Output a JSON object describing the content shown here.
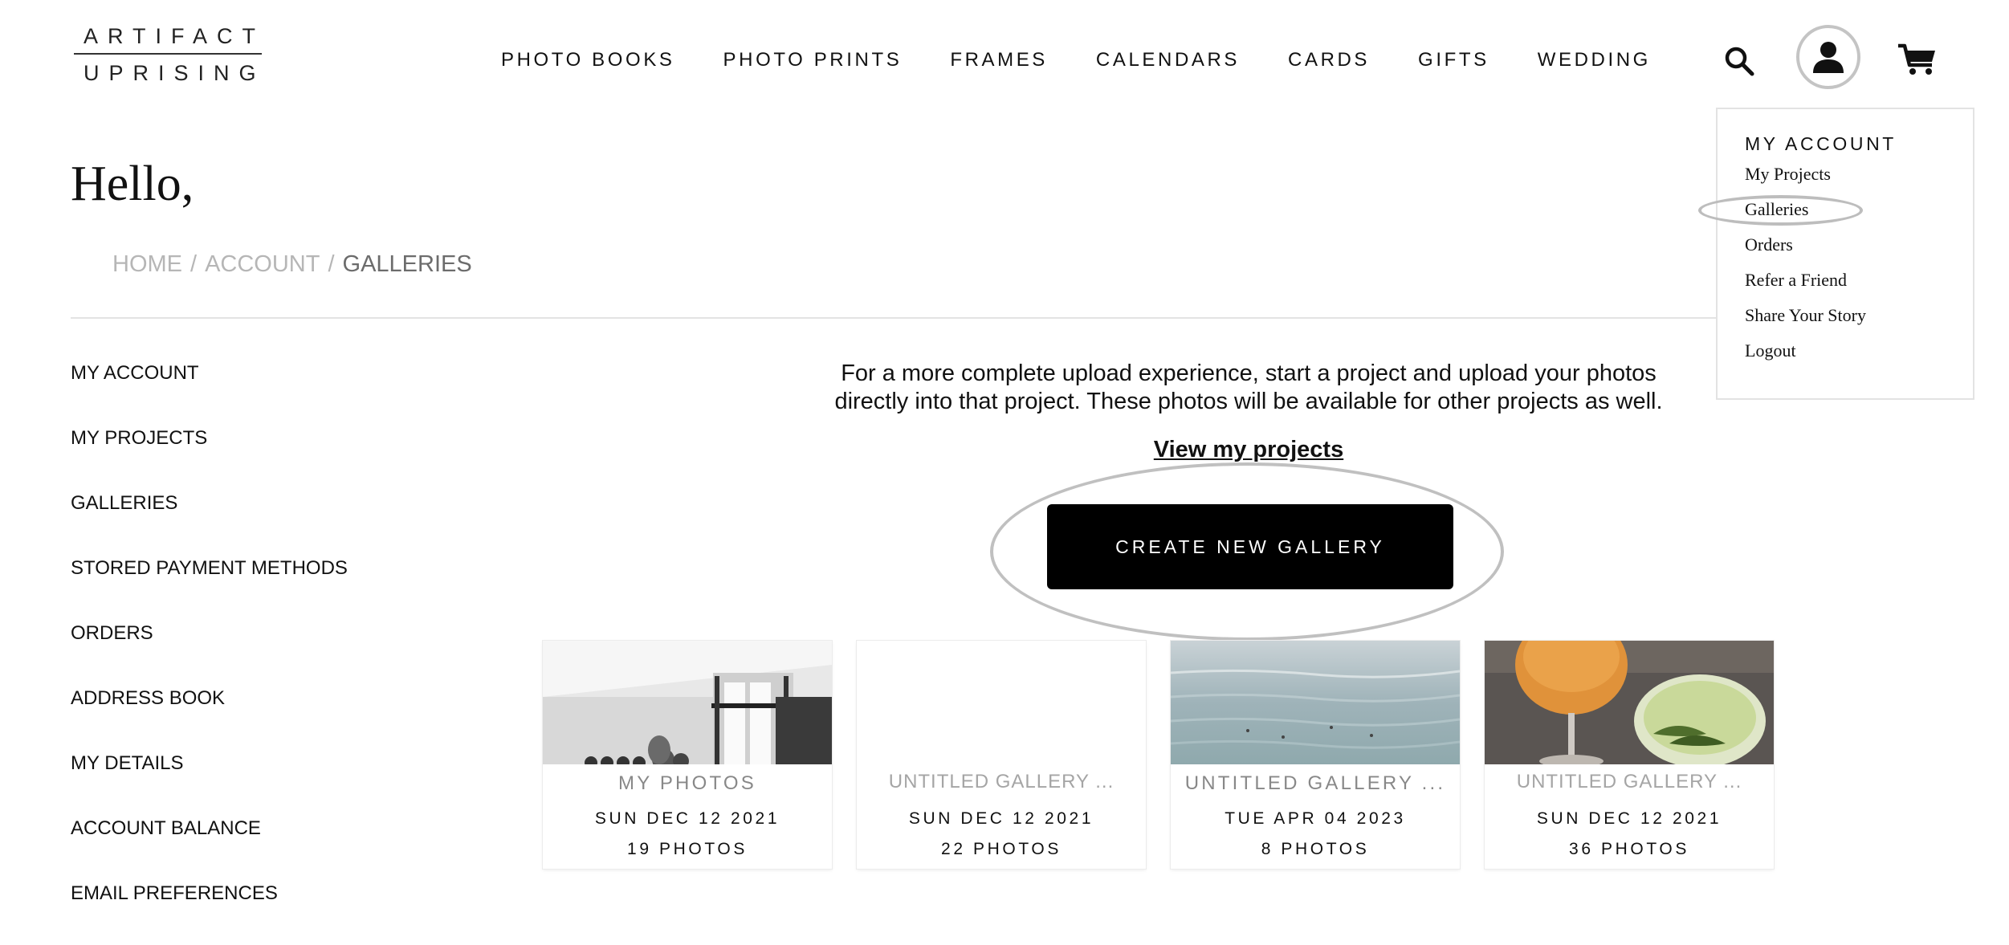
{
  "logo": {
    "line1": "ARTIFACT",
    "line2": "UPRISING"
  },
  "nav": {
    "items": [
      "PHOTO BOOKS",
      "PHOTO PRINTS",
      "FRAMES",
      "CALENDARS",
      "CARDS",
      "GIFTS",
      "WEDDING"
    ]
  },
  "header_icons": [
    "search-icon",
    "account-icon",
    "cart-icon"
  ],
  "dropdown": {
    "heading": "MY ACCOUNT",
    "items": [
      "My Projects",
      "Galleries",
      "Orders",
      "Refer a Friend",
      "Share Your Story",
      "Logout"
    ]
  },
  "page": {
    "greeting": "Hello,",
    "breadcrumb": {
      "home": "HOME",
      "account": "ACCOUNT",
      "current": "GALLERIES",
      "separator": "/"
    }
  },
  "sidebar": {
    "items": [
      "MY ACCOUNT",
      "MY PROJECTS",
      "GALLERIES",
      "STORED PAYMENT METHODS",
      "ORDERS",
      "ADDRESS BOOK",
      "MY DETAILS",
      "ACCOUNT BALANCE",
      "EMAIL PREFERENCES"
    ]
  },
  "main": {
    "intro_line1": "For a more complete upload experience, start a project and upload your photos",
    "intro_line2": "directly into that project. These photos will be available for other projects as well.",
    "view_projects": "View my projects",
    "create_button": "CREATE NEW GALLERY"
  },
  "galleries": [
    {
      "title": "MY PHOTOS",
      "date": "SUN DEC 12 2021",
      "count": "19 PHOTOS"
    },
    {
      "title": "UNTITLED GALLERY  ...",
      "date": "SUN DEC 12 2021",
      "count": "22 PHOTOS"
    },
    {
      "title": "UNTITLED GALLERY ...",
      "date": "TUE APR 04 2023",
      "count": "8 PHOTOS"
    },
    {
      "title": "UNTITLED GALLERY  ...",
      "date": "SUN DEC 12 2021",
      "count": "36 PHOTOS"
    }
  ],
  "colors": {
    "accent": "#000000",
    "muted_text": "#b6b6b6",
    "highlight_ring": "#c0c0c0"
  }
}
